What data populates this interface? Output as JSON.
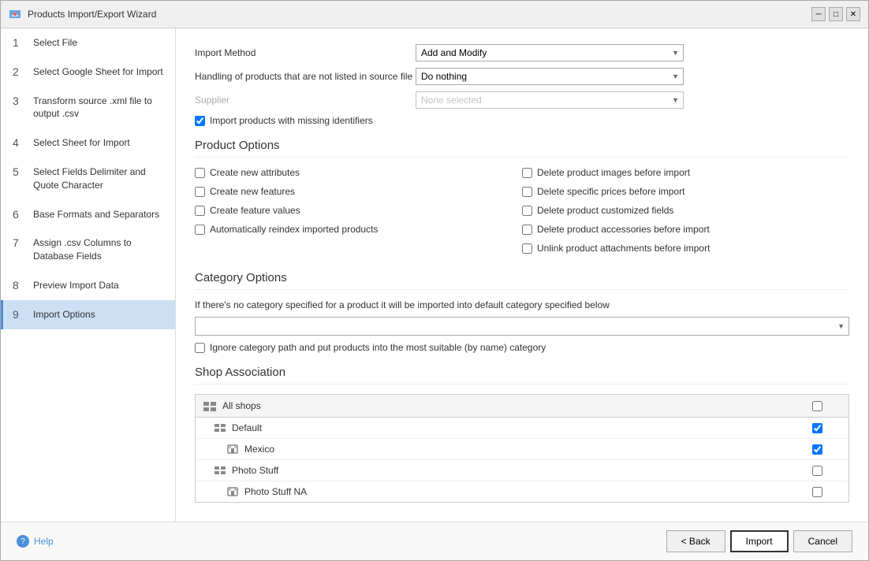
{
  "window": {
    "title": "Products Import/Export Wizard",
    "min_label": "─",
    "max_label": "□",
    "close_label": "✕"
  },
  "sidebar": {
    "items": [
      {
        "num": "1",
        "label": "Select File"
      },
      {
        "num": "2",
        "label": "Select Google Sheet for Import"
      },
      {
        "num": "3",
        "label": "Transform source .xml file to output .csv"
      },
      {
        "num": "4",
        "label": "Select Sheet for Import"
      },
      {
        "num": "5",
        "label": "Select Fields Delimiter and Quote Character"
      },
      {
        "num": "6",
        "label": "Base Formats and Separators"
      },
      {
        "num": "7",
        "label": "Assign .csv Columns to Database Fields"
      },
      {
        "num": "8",
        "label": "Preview Import Data"
      },
      {
        "num": "9",
        "label": "Import Options",
        "active": true
      }
    ]
  },
  "form": {
    "import_method_label": "Import Method",
    "import_method_value": "Add and Modify",
    "handling_label": "Handling of products that are not listed in source file",
    "handling_value": "Do nothing",
    "supplier_label": "Supplier",
    "supplier_value": "None selected",
    "missing_id_label": "Import products with missing identifiers"
  },
  "product_options": {
    "section_title": "Product Options",
    "left": [
      {
        "id": "cb1",
        "label": "Create new attributes",
        "checked": false
      },
      {
        "id": "cb2",
        "label": "Create new features",
        "checked": false
      },
      {
        "id": "cb3",
        "label": "Create feature values",
        "checked": false
      },
      {
        "id": "cb4",
        "label": "Automatically reindex imported products",
        "checked": false
      }
    ],
    "right": [
      {
        "id": "cb5",
        "label": "Delete product images before import",
        "checked": false
      },
      {
        "id": "cb6",
        "label": "Delete specific prices before import",
        "checked": false
      },
      {
        "id": "cb7",
        "label": "Delete product customized fields",
        "checked": false
      },
      {
        "id": "cb8",
        "label": "Delete product accessories before import",
        "checked": false
      },
      {
        "id": "cb9",
        "label": "Unlink product attachments before import",
        "checked": false
      }
    ]
  },
  "category_options": {
    "section_title": "Category Options",
    "description": "If there's no category specified for a product it will be imported into default category specified below",
    "default_category_placeholder": "",
    "ignore_path_label": "Ignore category path and put products into the most suitable (by name) category"
  },
  "shop_association": {
    "section_title": "Shop Association",
    "all_shops_label": "All shops",
    "shops": [
      {
        "level": 1,
        "label": "Default",
        "checked": true
      },
      {
        "level": 2,
        "label": "Mexico",
        "checked": true
      },
      {
        "level": 1,
        "label": "Photo Stuff",
        "checked": false
      },
      {
        "level": 2,
        "label": "Photo Stuff NA",
        "checked": false
      }
    ]
  },
  "footer": {
    "help_label": "Help",
    "back_label": "< Back",
    "import_label": "Import",
    "cancel_label": "Cancel"
  }
}
